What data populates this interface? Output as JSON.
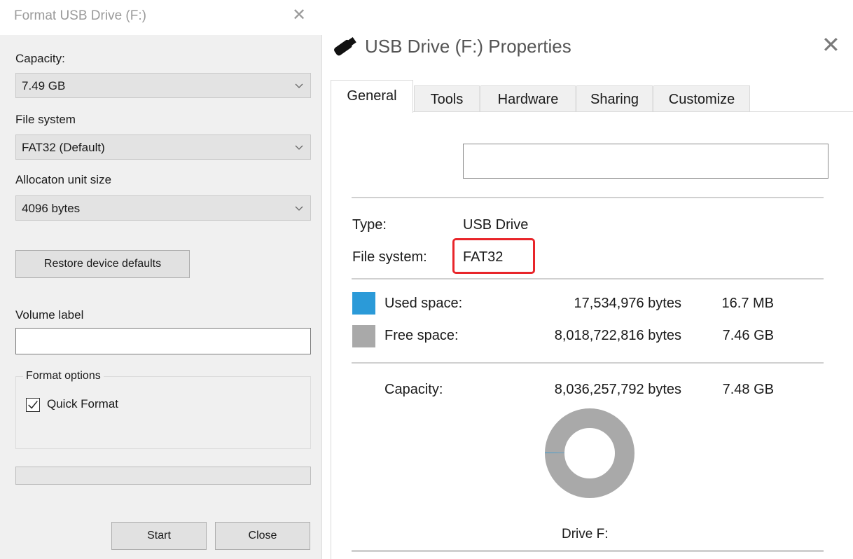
{
  "format_dialog": {
    "title": "Format USB Drive (F:)",
    "close_glyph": "✕",
    "capacity_label": "Capacity:",
    "capacity_value": "7.49 GB",
    "file_system_label": "File system",
    "file_system_value": "FAT32 (Default)",
    "alloc_label": "Allocaton unit size",
    "alloc_value": "4096 bytes",
    "restore_label": "Restore device defaults",
    "volume_label": "Volume label",
    "volume_value": "",
    "format_options_label": "Format options",
    "quick_format_label": "Quick Format",
    "quick_format_checked": true,
    "start_label": "Start",
    "close_label": "Close"
  },
  "properties_dialog": {
    "title": "USB Drive (F:) Properties",
    "close_glyph": "✕",
    "tabs": [
      {
        "label": "General",
        "active": true
      },
      {
        "label": "Tools",
        "active": false
      },
      {
        "label": "Hardware",
        "active": false
      },
      {
        "label": "Sharing",
        "active": false
      },
      {
        "label": "Customize",
        "active": false
      }
    ],
    "drive_name_value": "",
    "type_label": "Type:",
    "type_value": "USB Drive",
    "file_system_label": "File system:",
    "file_system_value": "FAT32",
    "used_label": "Used space:",
    "used_bytes": "17,534,976 bytes",
    "used_size": "16.7 MB",
    "free_label": "Free space:",
    "free_bytes": "8,018,722,816 bytes",
    "free_size": "7.46 GB",
    "capacity_label": "Capacity:",
    "capacity_bytes": "8,036,257,792 bytes",
    "capacity_size": "7.48 GB",
    "drive_label": "Drive F:",
    "used_fraction": 0.0022,
    "colors": {
      "used": "#2b9ad8",
      "free": "#a9a9a9",
      "highlight": "#e8252a"
    }
  }
}
